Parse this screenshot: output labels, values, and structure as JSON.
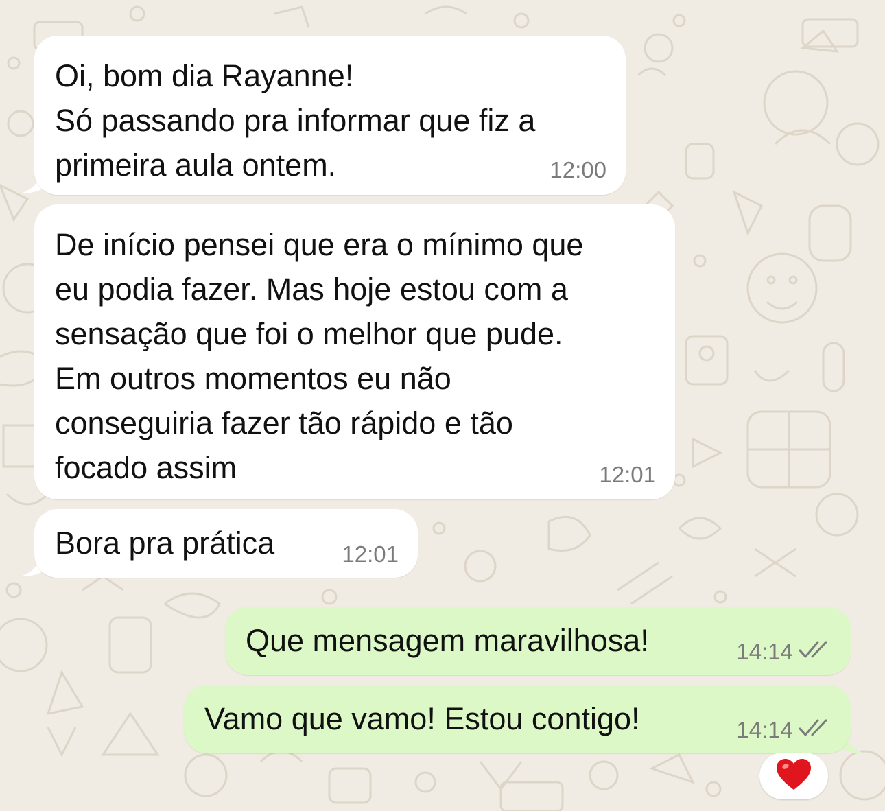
{
  "messages": [
    {
      "text": "Oi, bom dia Rayanne!\nSó passando pra informar que fiz a\nprimeira aula ontem.",
      "time": "12:00"
    },
    {
      "text": "De início pensei que era o mínimo que\neu podia fazer. Mas hoje estou com a\nsensação que foi o melhor que pude.\nEm outros momentos eu não\nconseguiria fazer tão rápido e tão\nfocado assim",
      "time": "12:01"
    },
    {
      "text": "Bora pra prática",
      "time": "12:01"
    },
    {
      "text": "Que mensagem maravilhosa!",
      "time": "14:14",
      "status": "read"
    },
    {
      "text": "Vamo que vamo! Estou contigo!",
      "time": "14:14",
      "status": "read"
    }
  ],
  "reaction": {
    "emoji": "heart",
    "color": "#e0161f"
  },
  "colors": {
    "wallpaper": "#f0ebe3",
    "wallpaper_pattern": "#ddd5c8",
    "incoming_bubble": "#ffffff",
    "outgoing_bubble": "#dcf8c6",
    "timestamp": "#7b7b7b",
    "read_check": "#7b7b7b"
  }
}
